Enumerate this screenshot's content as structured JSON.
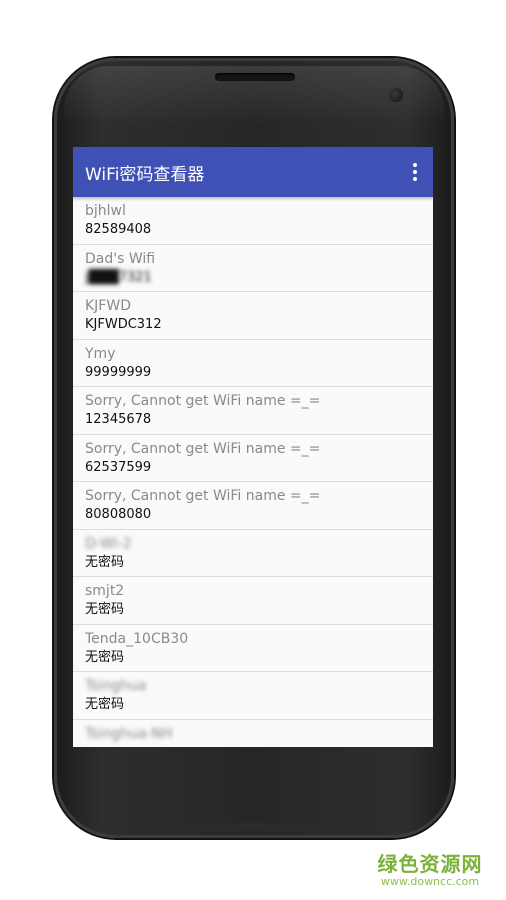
{
  "app": {
    "title": "WiFi密码查看器",
    "overflow_icon": "more-vert-icon",
    "accent_color": "#3f51b5"
  },
  "networks": [
    {
      "ssid": "bjhlwl",
      "password": "82589408",
      "blurred_ssid": false,
      "blurred_password": false
    },
    {
      "ssid": "Dad's Wifi",
      "password": "j███7321",
      "blurred_ssid": false,
      "blurred_password": true
    },
    {
      "ssid": "KJFWD",
      "password": "KJFWDC312",
      "blurred_ssid": false,
      "blurred_password": false
    },
    {
      "ssid": "Ymy",
      "password": "99999999",
      "blurred_ssid": false,
      "blurred_password": false
    },
    {
      "ssid": "Sorry, Cannot get WiFi name =_=",
      "password": "12345678",
      "blurred_ssid": false,
      "blurred_password": false
    },
    {
      "ssid": "Sorry, Cannot get WiFi name =_=",
      "password": "62537599",
      "blurred_ssid": false,
      "blurred_password": false
    },
    {
      "ssid": "Sorry, Cannot get WiFi name =_=",
      "password": "80808080",
      "blurred_ssid": false,
      "blurred_password": false
    },
    {
      "ssid": "D-Wi-2",
      "password": "无密码",
      "blurred_ssid": true,
      "blurred_password": false
    },
    {
      "ssid": "smjt2",
      "password": "无密码",
      "blurred_ssid": false,
      "blurred_password": false
    },
    {
      "ssid": "Tenda_10CB30",
      "password": "无密码",
      "blurred_ssid": false,
      "blurred_password": false
    },
    {
      "ssid": "Tsinghua",
      "password": "无密码",
      "blurred_ssid": true,
      "blurred_password": false
    },
    {
      "ssid": "Tsinghua-NH",
      "password": "",
      "blurred_ssid": true,
      "blurred_password": false
    }
  ],
  "watermark": {
    "main": "绿色资源网",
    "url": "www.downcc.com"
  }
}
